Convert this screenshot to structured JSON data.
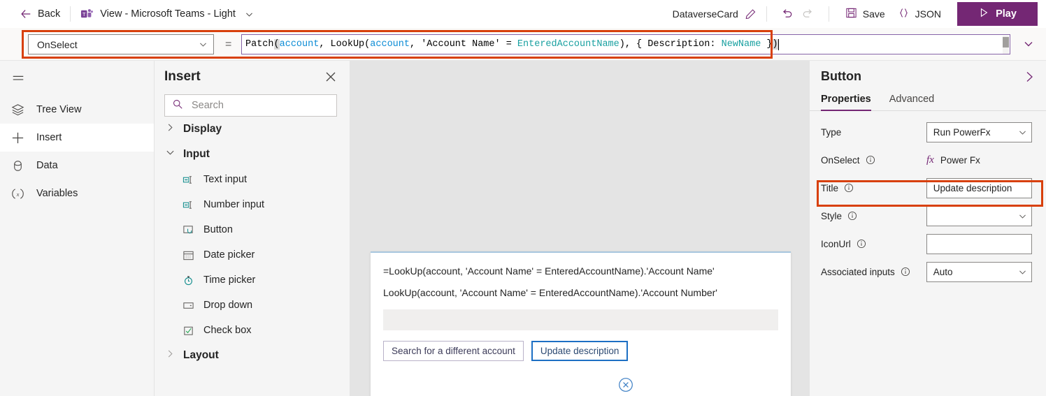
{
  "topbar": {
    "back_label": "Back",
    "doc_title": "View - Microsoft Teams - Light",
    "app_name": "DataverseCard",
    "undo_name": "undo-icon",
    "redo_name": "redo-icon",
    "save_label": "Save",
    "json_label": "JSON",
    "play_label": "Play",
    "play_color": "#742774"
  },
  "formula_bar": {
    "property": "OnSelect",
    "equals": "=",
    "formula_full": "Patch(account, LookUp(account, 'Account Name' = EnteredAccountName), { Description: NewName })",
    "tokens": [
      {
        "t": "Patch",
        "k": "fn"
      },
      {
        "t": "(",
        "k": "paren-hl"
      },
      {
        "t": "account",
        "k": "tbl"
      },
      {
        "t": ", ",
        "k": "pun"
      },
      {
        "t": "LookUp",
        "k": "fn"
      },
      {
        "t": "(",
        "k": "pun"
      },
      {
        "t": "account",
        "k": "tbl"
      },
      {
        "t": ", ",
        "k": "pun"
      },
      {
        "t": "'Account Name'",
        "k": "fn"
      },
      {
        "t": " = ",
        "k": "pun"
      },
      {
        "t": "EnteredAccountName",
        "k": "var"
      },
      {
        "t": "), { ",
        "k": "pun"
      },
      {
        "t": "Description: ",
        "k": "fn"
      },
      {
        "t": "NewName",
        "k": "var"
      },
      {
        "t": " }",
        "k": "pun"
      },
      {
        "t": ")",
        "k": "paren-hl"
      }
    ],
    "highlight_color": "#d8400c"
  },
  "rail": {
    "menu_icon": "hamburger-icon",
    "items": [
      {
        "label": "Tree View",
        "icon": "layers-icon",
        "active": false
      },
      {
        "label": "Insert",
        "icon": "plus-icon",
        "active": true
      },
      {
        "label": "Data",
        "icon": "database-icon",
        "active": false
      },
      {
        "label": "Variables",
        "icon": "variables-icon",
        "active": false
      }
    ]
  },
  "insert_panel": {
    "title": "Insert",
    "search_placeholder": "Search",
    "search_value": "",
    "groups": [
      {
        "label": "Display",
        "expanded": false,
        "items": []
      },
      {
        "label": "Input",
        "expanded": true,
        "items": [
          {
            "label": "Text input",
            "icon": "text-input-icon"
          },
          {
            "label": "Number input",
            "icon": "number-input-icon"
          },
          {
            "label": "Button",
            "icon": "button-icon"
          },
          {
            "label": "Date picker",
            "icon": "calendar-icon"
          },
          {
            "label": "Time picker",
            "icon": "clock-icon"
          },
          {
            "label": "Drop down",
            "icon": "dropdown-icon"
          },
          {
            "label": "Check box",
            "icon": "checkbox-icon"
          }
        ]
      },
      {
        "label": "Layout",
        "expanded": false,
        "items": []
      }
    ]
  },
  "canvas": {
    "card": {
      "line1": "=LookUp(account, 'Account Name' = EnteredAccountName).'Account Name'",
      "line2": "LookUp(account, 'Account Name' = EnteredAccountName).'Account Number'",
      "input_value": "",
      "buttons": [
        {
          "label": "Search for a different account",
          "selected": false
        },
        {
          "label": "Update description",
          "selected": true
        }
      ],
      "delete_handle": "delete-circle-icon"
    }
  },
  "right_panel": {
    "title": "Button",
    "tabs": [
      {
        "label": "Properties",
        "active": true
      },
      {
        "label": "Advanced",
        "active": false
      }
    ],
    "properties": [
      {
        "name": "Type",
        "info": true,
        "control": "select",
        "value": "Run PowerFx"
      },
      {
        "name": "OnSelect",
        "info": true,
        "control": "fx",
        "value": "Power Fx"
      },
      {
        "name": "Title",
        "info": true,
        "control": "text",
        "value": "Update description",
        "highlighted": true
      },
      {
        "name": "Style",
        "info": true,
        "control": "select",
        "value": ""
      },
      {
        "name": "IconUrl",
        "info": true,
        "control": "text",
        "value": ""
      },
      {
        "name": "Associated inputs",
        "info": true,
        "control": "select",
        "value": "Auto"
      }
    ]
  }
}
